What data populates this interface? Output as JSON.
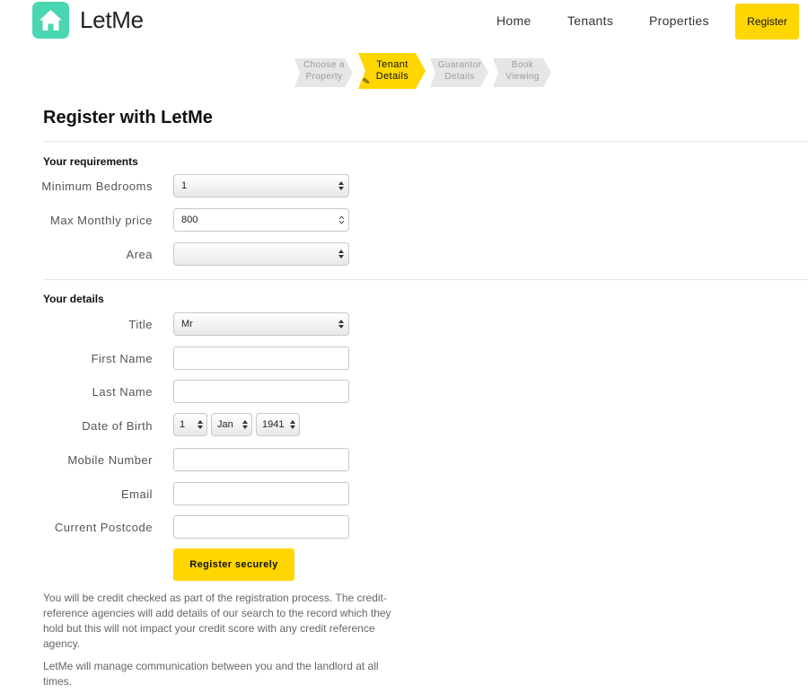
{
  "header": {
    "brand": "LetMe",
    "nav": [
      {
        "label": "Home"
      },
      {
        "label": "Tenants"
      },
      {
        "label": "Properties"
      },
      {
        "label": "Register"
      }
    ],
    "accent_color": "#ffd600",
    "logo_color": "#49d6b0",
    "logo_icon": "house-icon"
  },
  "steps": [
    {
      "line1": "Choose a",
      "line2": "Property",
      "state": "inactive"
    },
    {
      "line1": "Tenant",
      "line2": "Details",
      "state": "active"
    },
    {
      "line1": "Guarantor",
      "line2": "Details",
      "state": "inactive"
    },
    {
      "line1": "Book",
      "line2": "Viewing",
      "state": "inactive"
    }
  ],
  "page": {
    "title": "Register with LetMe"
  },
  "requirements": {
    "heading": "Your requirements",
    "min_bedrooms": {
      "label": "Minimum Bedrooms",
      "value": "1"
    },
    "max_price": {
      "label": "Max Monthly price",
      "value": "800"
    },
    "area": {
      "label": "Area",
      "value": ""
    }
  },
  "details": {
    "heading": "Your details",
    "title": {
      "label": "Title",
      "value": "Mr"
    },
    "first_name": {
      "label": "First Name",
      "value": ""
    },
    "last_name": {
      "label": "Last Name",
      "value": ""
    },
    "dob": {
      "label": "Date of Birth",
      "day": "1",
      "month": "Jan",
      "year": "1941"
    },
    "mobile": {
      "label": "Mobile Number",
      "value": ""
    },
    "email": {
      "label": "Email",
      "value": ""
    },
    "postcode": {
      "label": "Current Postcode",
      "value": ""
    }
  },
  "submit_label": "Register securely",
  "notices": [
    "You will be credit checked as part of the registration process. The credit-reference agencies will add details of our search to the record which they hold but this will not impact your credit score with any credit reference agency.",
    "LetMe will manage communication between you and the landlord at all times."
  ]
}
